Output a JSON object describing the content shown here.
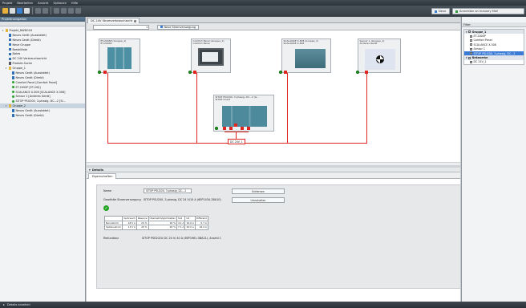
{
  "menu": [
    "Projekt",
    "Bearbeiten",
    "Ansicht",
    "Optionen",
    "Hilfe"
  ],
  "toolbar": {
    "right_buttons": [
      {
        "label": "Neue",
        "icon": "new-icon"
      },
      {
        "label": "Anmelden an Industry Mall",
        "icon": "mall-icon"
      }
    ]
  },
  "left_pane": {
    "title": "Projektnavigation",
    "tree": [
      {
        "label": "Projekt_NWD018",
        "level": 0,
        "icon": "folder",
        "twisty": "▾"
      },
      {
        "label": "Neues Gerät (Ausstattet)",
        "level": 1,
        "icon": "blue"
      },
      {
        "label": "Neues Gerät (Direkt)",
        "level": 1,
        "icon": "blue"
      },
      {
        "label": "Neue Gruppe",
        "level": 1,
        "icon": "blue"
      },
      {
        "label": "Bestellliste",
        "level": 1,
        "icon": "blue"
      },
      {
        "label": "Notes",
        "level": 1,
        "icon": "blue"
      },
      {
        "label": "DC 24V Verbrauchsericht",
        "level": 1,
        "icon": "blue"
      },
      {
        "label": "Produkt-Suche",
        "level": 1,
        "icon": "dk"
      },
      {
        "label": "Gruppe_1",
        "level": 1,
        "icon": "folder",
        "twisty": "▾"
      },
      {
        "label": "Neues Gerät (Ausstattet)",
        "level": 2,
        "icon": "blue"
      },
      {
        "label": "Neues Gerät (Direkt)",
        "level": 2,
        "icon": "blue"
      },
      {
        "label": "Comfort Panel [Comfort Panel]",
        "level": 2,
        "icon": "green"
      },
      {
        "label": "ET-200SP [ET-200]",
        "level": 2,
        "icon": "green"
      },
      {
        "label": "SCALANCE X-308 [SCALANCE X-308]",
        "level": 2,
        "icon": "green"
      },
      {
        "label": "Sensor 1 [Anderes Gerät]",
        "level": 2,
        "icon": "green"
      },
      {
        "label": "SITOP PSU200, 3-phasig, DC...2 [SI...",
        "level": 2,
        "icon": "green"
      },
      {
        "label": "Gruppe_2",
        "level": 1,
        "icon": "folder",
        "twisty": "▾",
        "selected": true
      },
      {
        "label": "Neues Gerät (Ausstattet)",
        "level": 2,
        "icon": "blue"
      },
      {
        "label": "Neues Gerät (Direkt)",
        "level": 2,
        "icon": "blue"
      }
    ]
  },
  "document": {
    "tab_label": "DC 24V Stromverbrauchsicht",
    "view_select": "",
    "view_button": "Neue Stromversorgung"
  },
  "devices": [
    {
      "id": "et200",
      "name_lines": [
        "ET-200SP (Gruppe_1)",
        "ET-200SP"
      ]
    },
    {
      "id": "comfort",
      "name_lines": [
        "Comfort Panel (Gruppe_1)",
        "Comfort Panel"
      ]
    },
    {
      "id": "scalance",
      "name_lines": [
        "SCALANCE X-308 (Gruppe_1)",
        "SCALANCE X-308"
      ]
    },
    {
      "id": "sensor",
      "name_lines": [
        "Sensor 1 (Gruppe_1)",
        "Anderes Gerät"
      ]
    },
    {
      "id": "sitop",
      "name_lines": [
        "SITOP PSU200, 3-phasig, DC...2 (G...",
        "SITOP smart"
      ]
    }
  ],
  "bus_label": "DC 24V_1",
  "details": {
    "title": "Details",
    "tab": "Eigenschaften",
    "name_label": "Name",
    "name_value": "SITOP PSU200, 3-phasig, DC...2",
    "supply_label": "Gewählte Stromversorgung",
    "supply_value": "SITOP PSU200, 3-phasig, DC 24 V/10 A (6EP1434-2BA10)",
    "buttons": [
      "Entfernen",
      "Umschalten"
    ],
    "table": {
      "header": [
        "",
        "Verbrauch",
        "Reserve",
        "Überlastmöglichkeiten",
        "Soll",
        "Ist",
        "Differenz"
      ],
      "rows": [
        [
          "Nennstrom",
          "18.5 A",
          "20 %",
          "90 %",
          "4.1 A",
          "10.0 A",
          "5.7 A"
        ],
        [
          "Spitzenstrom",
          "13.5 A",
          "20 %",
          "90 %",
          "7.1 A",
          "20.0 A",
          "18.4 A"
        ]
      ]
    },
    "result_label": "Redundanz",
    "result_value": "SITOP PSE202U DC 24 V/ 40 A (6EP1961-3BA21), Anzahl 1"
  },
  "right_pane": {
    "title": "Filter",
    "groups": [
      {
        "label": "Gruppe_1",
        "items": [
          "ET-200SP",
          "Comfort Panel",
          "SCALANCE X-308",
          "Sensor 1",
          "SITOP PSU200, 3-phasig, DC...2"
        ],
        "selected_index": 4
      },
      {
        "label": "Netzwerke",
        "items": [
          "DC 24V_1"
        ]
      }
    ]
  },
  "status": {
    "text": "Details ansehen"
  },
  "colors": {
    "accent": "#e0241f",
    "ok": "#20a020",
    "header": "#4a657b"
  }
}
